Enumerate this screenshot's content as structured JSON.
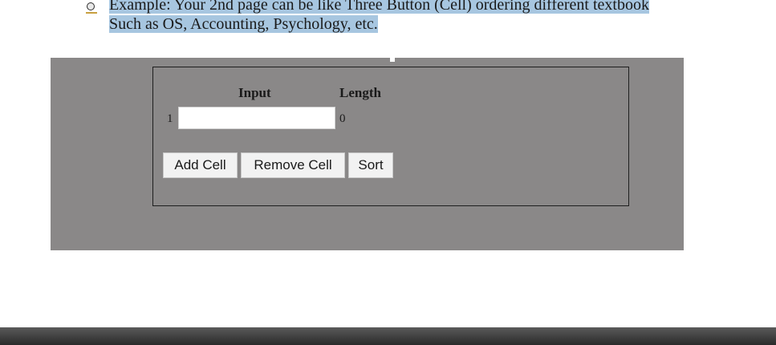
{
  "document": {
    "line1": "Example:  Your 2nd page can be like Three Button (Cell) ordering different textbook",
    "line2": "Such as OS, Accounting, Psychology, etc. "
  },
  "app": {
    "headers": {
      "input": "Input",
      "length": "Length"
    },
    "rows": [
      {
        "index": "1",
        "value": "",
        "length": "0"
      }
    ],
    "buttons": {
      "add": "Add Cell",
      "remove": "Remove Cell",
      "sort": "Sort"
    }
  },
  "colors": {
    "highlight": "#a7c6e0",
    "embed_background": "#8a8888",
    "bottom_bar": "#3a3a3a"
  }
}
